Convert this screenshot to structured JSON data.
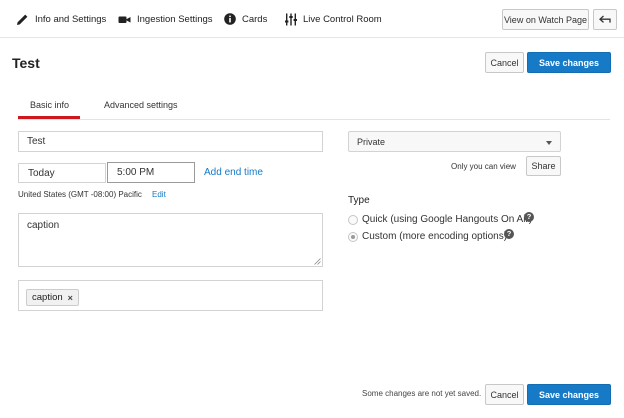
{
  "topbar": {
    "items": [
      {
        "label": "Info and Settings",
        "icon": "pencil-icon"
      },
      {
        "label": "Ingestion Settings",
        "icon": "video-camera-icon"
      },
      {
        "label": "Cards",
        "icon": "info-icon"
      },
      {
        "label": "Live Control Room",
        "icon": "sliders-icon"
      }
    ],
    "watch_page_label": "View on Watch Page",
    "back_icon": "back-arrow-icon"
  },
  "header": {
    "title": "Test",
    "cancel_label": "Cancel",
    "save_label": "Save changes"
  },
  "tabs": [
    {
      "label": "Basic info",
      "active": true
    },
    {
      "label": "Advanced settings",
      "active": false
    }
  ],
  "form": {
    "title_value": "Test",
    "date_value": "Today",
    "time_value": "5:00 PM",
    "add_end_time_label": "Add end time",
    "timezone_text": "United States (GMT -08:00) Pacific",
    "timezone_edit_label": "Edit",
    "description_value": "caption",
    "tags": [
      {
        "label": "caption",
        "remove": "×"
      }
    ]
  },
  "privacy": {
    "selected": "Private",
    "hint": "Only you can view",
    "share_label": "Share"
  },
  "type_section": {
    "heading": "Type",
    "options": [
      {
        "name": "Quick",
        "detail": "(using Google Hangouts On Air)",
        "checked": false
      },
      {
        "name": "Custom",
        "detail": "(more encoding options)",
        "checked": true
      }
    ],
    "help_glyph": "?"
  },
  "footer": {
    "status": "Some changes are not yet saved.",
    "cancel_label": "Cancel",
    "save_label": "Save changes"
  },
  "colors": {
    "accent": "#167ac6",
    "tab_underline": "#cc181e"
  }
}
